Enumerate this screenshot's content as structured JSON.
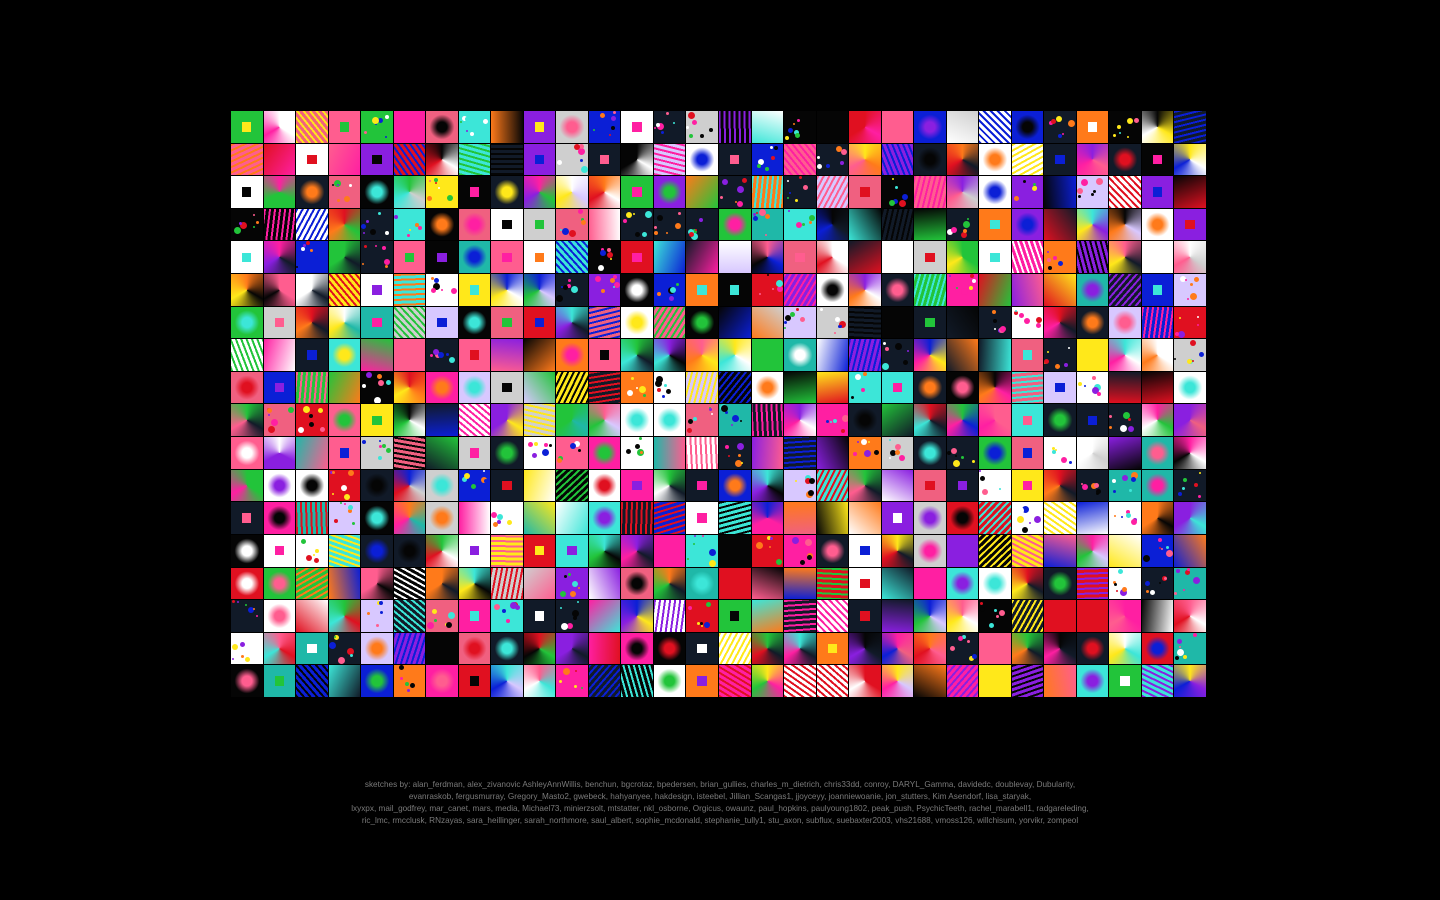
{
  "gallery": {
    "columns": 30,
    "rows": 18,
    "palette": {
      "navy": "#111a28",
      "white": "#ffffff",
      "black": "#050505",
      "magenta": "#ff1fa2",
      "pink": "#ff5d8f",
      "red": "#e01020",
      "blue": "#0b1fd6",
      "green": "#22c43a",
      "yellow": "#ffe81a",
      "cyan": "#3ce6d8",
      "purple": "#8a1fe0",
      "gray": "#cfcfcf",
      "orange": "#ff7a1a",
      "teal": "#1fb8a8",
      "rose": "#f06080",
      "lavender": "#d8c8ff"
    }
  },
  "credits": {
    "lines": [
      "sketches by: alan_ferdman, alex_zivanovic AshleyAnnWillis, benchun, bgcrotaz, bpedersen, brian_gullies, charles_m_dietrich, chris33dd, conroy, DARYL_Gamma, davidedc, doublevay, Dubularity,",
      "evanraskob, fergusmurray, Gregory_Masto2, gwebeck, hahyanyee, hakdesign, isteebel, Jillian_Scangas1, jjoyceyy, joanniewoanie, jon_stutters, Kim Asendorf, lisa_staryak,",
      "lxyxpx, mail_godfrey, mar_canet, mars, media, Michael73, minierzsolt, mtstatter, nkl_osborne, Orgicus, owaunz, paul_hopkins, paulyoung1802, peak_push, PsychicTeeth, rachel_marabell1, radgareleding,",
      "ric_lmc, rmcclusk, RNzayas, sara_heillinger, sarah_northmore, saul_albert, sophie_mcdonald, stephanie_tully1, stu_axon, subflux, suebaxter2003, vhs21688, vmoss126, willchisum, yorvikr, zompeol"
    ]
  }
}
